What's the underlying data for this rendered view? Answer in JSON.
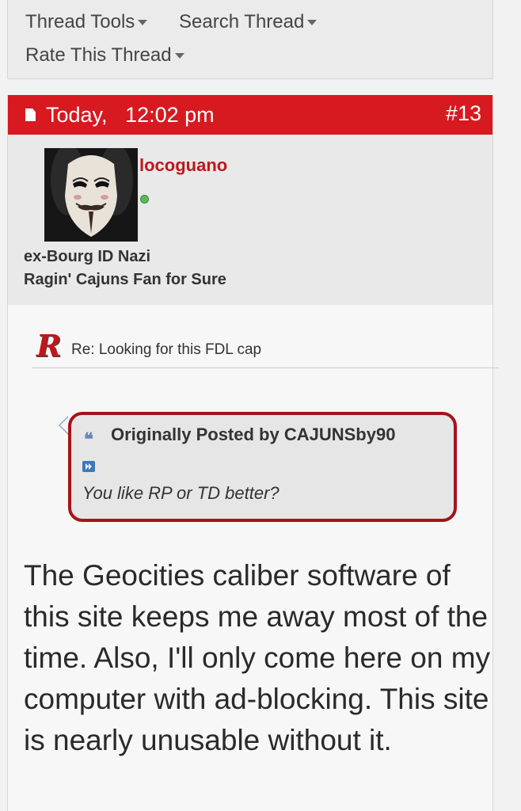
{
  "tools": {
    "thread_tools": "Thread Tools",
    "search_thread": "Search Thread",
    "rate_thread": "Rate This Thread"
  },
  "post": {
    "date": "Today,   12:02 pm",
    "number": "#13",
    "username": "locoguano",
    "user_title_1": "ex-Bourg ID Nazi",
    "user_title_2": "Ragin' Cajuns Fan for Sure",
    "title": "Re: Looking for this FDL cap",
    "quote": {
      "prefix": "Originally Posted by",
      "author": "CAJUNSby90",
      "text": "You like RP or TD better?"
    },
    "message": "The Geocities caliber software of this site keeps me away most of the time. Also, I'll only come here on my computer with ad-blocking. This site is nearly unusable without it."
  },
  "colors": {
    "header_red": "#d71920",
    "username_red": "#c0161c",
    "quote_border": "#a51419",
    "online_green": "#5cb85c"
  },
  "icons": [
    "caret-down-icon",
    "document-icon",
    "online-status-icon",
    "r-logo-icon",
    "quote-icon",
    "view-post-icon"
  ]
}
